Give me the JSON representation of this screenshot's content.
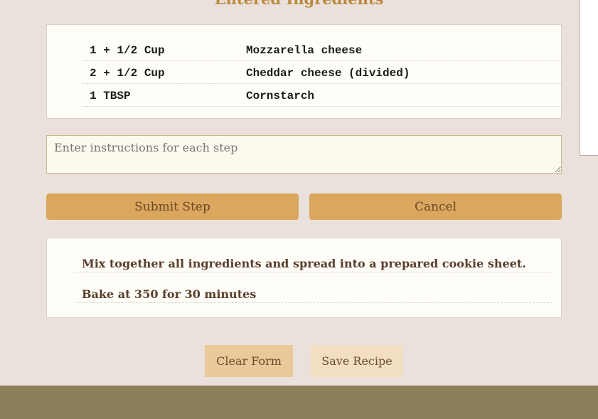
{
  "section_heading": "Entered Ingredients",
  "ingredients": [
    {
      "quantity": "1 + 1/2 Cup",
      "name": "Mozzarella cheese"
    },
    {
      "quantity": "2 + 1/2 Cup",
      "name": "Cheddar cheese (divided)"
    },
    {
      "quantity": "1 TBSP",
      "name": "Cornstarch"
    }
  ],
  "instructions_input": {
    "placeholder": "Enter instructions for each step",
    "value": ""
  },
  "step_buttons": {
    "submit": "Submit Step",
    "cancel": "Cancel"
  },
  "steps": [
    "Mix together all ingredients and spread into a prepared cookie sheet.",
    "Bake at 350 for 30 minutes"
  ],
  "form_buttons": {
    "clear": "Clear Form",
    "save": "Save Recipe"
  },
  "colors": {
    "background": "#ebe1dc",
    "accent_button": "#dba65e",
    "footer": "#8b7f59",
    "heading": "#b98a3e"
  }
}
